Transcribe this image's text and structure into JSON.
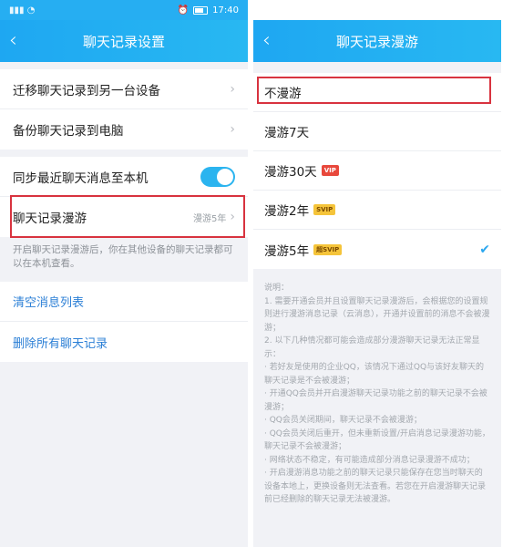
{
  "left": {
    "status": {
      "time": "17:40"
    },
    "nav": {
      "title": "聊天记录设置"
    },
    "rows": {
      "migrate": "迁移聊天记录到另一台设备",
      "backup": "备份聊天记录到电脑",
      "sync": "同步最近聊天消息至本机",
      "roaming_label": "聊天记录漫游",
      "roaming_value": "漫游5年"
    },
    "hint": "开启聊天记录漫游后，你在其他设备的聊天记录都可以在本机查看。",
    "clear_list": "清空消息列表",
    "delete_all": "删除所有聊天记录"
  },
  "right": {
    "nav": {
      "title": "聊天记录漫游"
    },
    "options": [
      {
        "label": "不漫游",
        "badge": ""
      },
      {
        "label": "漫游7天",
        "badge": ""
      },
      {
        "label": "漫游30天",
        "badge": "VIP"
      },
      {
        "label": "漫游2年",
        "badge": "SVIP"
      },
      {
        "label": "漫游5年",
        "badge": "超SVIP"
      }
    ],
    "notes": [
      "说明：",
      "1. 需要开通会员并且设置聊天记录漫游后，会根据您的设置规则进行漫游消息记录（云消息），开通并设置前的消息不会被漫游；",
      "2. 以下几种情况都可能会造成部分漫游聊天记录无法正常显示：",
      "· 若好友是使用的企业QQ，该情况下通过QQ与该好友聊天的聊天记录是不会被漫游；",
      "· 开通QQ会员并开启漫游聊天记录功能之前的聊天记录不会被漫游；",
      "· QQ会员关闭期间，聊天记录不会被漫游；",
      "· QQ会员关闭后重开，但未重新设置/开启消息记录漫游功能，聊天记录不会被漫游；",
      "· 网络状态不稳定，有可能造成部分消息记录漫游不成功；",
      "· 开启漫游消息功能之前的聊天记录只能保存在您当时聊天的设备本地上，更换设备则无法查看。若您在开启漫游聊天记录前已经删除的聊天记录无法被漫游。"
    ]
  },
  "colors": {
    "accent": "#26aef2",
    "highlight": "#d8333f",
    "toggle_on": "#2bb4ef"
  }
}
